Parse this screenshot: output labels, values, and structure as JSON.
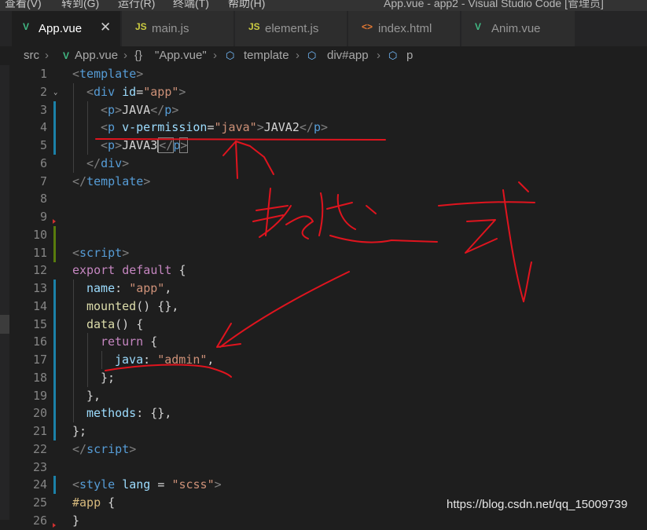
{
  "menubar": {
    "items": [
      "查看(V)",
      "转到(G)",
      "运行(R)",
      "终端(T)",
      "帮助(H)"
    ],
    "window_title": "App.vue - app2 - Visual Studio Code [管理员]"
  },
  "tabs": [
    {
      "label": "App.vue",
      "icon": "V",
      "icon_name": "vue-icon",
      "icon_color": "#41b883",
      "active": true
    },
    {
      "label": "main.js",
      "icon": "JS",
      "icon_name": "js-icon",
      "icon_color": "#cbcb41",
      "active": false
    },
    {
      "label": "element.js",
      "icon": "JS",
      "icon_name": "js-icon",
      "icon_color": "#cbcb41",
      "active": false
    },
    {
      "label": "index.html",
      "icon": "<>",
      "icon_name": "html-icon",
      "icon_color": "#e37933",
      "active": false
    },
    {
      "label": "Anim.vue",
      "icon": "V",
      "icon_name": "vue-icon",
      "icon_color": "#41b883",
      "active": false
    }
  ],
  "tab_close_glyph": "✕",
  "breadcrumb": {
    "items": [
      "src",
      "App.vue",
      "\"App.vue\"",
      "template",
      "div#app",
      "p"
    ],
    "icons": [
      "folder",
      "vue-icon",
      "braces-icon",
      "element-icon",
      "element-icon",
      "element-icon"
    ],
    "braces_glyph": "{}",
    "element_glyph": "⬡"
  },
  "code": {
    "line_numbers": [
      "1",
      "2",
      "3",
      "4",
      "5",
      "6",
      "7",
      "8",
      "9",
      "10",
      "11",
      "12",
      "13",
      "14",
      "15",
      "16",
      "17",
      "18",
      "19",
      "20",
      "21",
      "22",
      "23",
      "24",
      "25",
      "26"
    ],
    "lines": [
      [
        {
          "c": "t",
          "v": "<"
        },
        {
          "c": "tn",
          "v": "template"
        },
        {
          "c": "t",
          "v": ">"
        }
      ],
      [
        {
          "c": "t",
          "v": "<"
        },
        {
          "c": "tn",
          "v": "div"
        },
        {
          "c": "pu",
          "v": " "
        },
        {
          "c": "at",
          "v": "id"
        },
        {
          "c": "pu",
          "v": "="
        },
        {
          "c": "sv",
          "v": "\"app\""
        },
        {
          "c": "t",
          "v": ">"
        }
      ],
      [
        {
          "c": "t",
          "v": "<"
        },
        {
          "c": "tn",
          "v": "p"
        },
        {
          "c": "t",
          "v": ">"
        },
        {
          "c": "pu",
          "v": "JAVA"
        },
        {
          "c": "t",
          "v": "</"
        },
        {
          "c": "tn",
          "v": "p"
        },
        {
          "c": "t",
          "v": ">"
        }
      ],
      [
        {
          "c": "t",
          "v": "<"
        },
        {
          "c": "tn",
          "v": "p"
        },
        {
          "c": "pu",
          "v": " "
        },
        {
          "c": "at",
          "v": "v-permission"
        },
        {
          "c": "pu",
          "v": "="
        },
        {
          "c": "sv",
          "v": "\"java\""
        },
        {
          "c": "t",
          "v": ">"
        },
        {
          "c": "pu",
          "v": "JAVA2"
        },
        {
          "c": "t",
          "v": "</"
        },
        {
          "c": "tn",
          "v": "p"
        },
        {
          "c": "t",
          "v": ">"
        }
      ],
      [
        {
          "c": "t",
          "v": "<"
        },
        {
          "c": "tn",
          "v": "p"
        },
        {
          "c": "t",
          "v": ">"
        },
        {
          "c": "pu",
          "v": "JAVA3"
        },
        {
          "c": "cursor",
          "v": ""
        },
        {
          "c": "t curbox",
          "v": "</"
        },
        {
          "c": "tn",
          "v": "p"
        },
        {
          "c": "t curbox",
          "v": ">"
        }
      ],
      [
        {
          "c": "t",
          "v": "</"
        },
        {
          "c": "tn",
          "v": "div"
        },
        {
          "c": "t",
          "v": ">"
        }
      ],
      [
        {
          "c": "t",
          "v": "</"
        },
        {
          "c": "tn",
          "v": "template"
        },
        {
          "c": "t",
          "v": ">"
        }
      ],
      [],
      [],
      [],
      [
        {
          "c": "t",
          "v": "<"
        },
        {
          "c": "tn",
          "v": "script"
        },
        {
          "c": "t",
          "v": ">"
        }
      ],
      [
        {
          "c": "kw",
          "v": "export"
        },
        {
          "c": "pu",
          "v": " "
        },
        {
          "c": "kw",
          "v": "default"
        },
        {
          "c": "pu",
          "v": " {"
        }
      ],
      [
        {
          "c": "pr",
          "v": "name"
        },
        {
          "c": "pu",
          "v": ": "
        },
        {
          "c": "sv",
          "v": "\"app\""
        },
        {
          "c": "pu",
          "v": ","
        }
      ],
      [
        {
          "c": "fn",
          "v": "mounted"
        },
        {
          "c": "pu",
          "v": "() {},"
        }
      ],
      [
        {
          "c": "fn",
          "v": "data"
        },
        {
          "c": "pu",
          "v": "() {"
        }
      ],
      [
        {
          "c": "kw",
          "v": "return"
        },
        {
          "c": "pu",
          "v": " {"
        }
      ],
      [
        {
          "c": "pr",
          "v": "java"
        },
        {
          "c": "pu",
          "v": ": "
        },
        {
          "c": "sv",
          "v": "\"admin\""
        },
        {
          "c": "pu",
          "v": ","
        }
      ],
      [
        {
          "c": "pu",
          "v": "};"
        }
      ],
      [
        {
          "c": "pu",
          "v": "},"
        }
      ],
      [
        {
          "c": "pr",
          "v": "methods"
        },
        {
          "c": "pu",
          "v": ": {},"
        }
      ],
      [
        {
          "c": "pu",
          "v": "};"
        }
      ],
      [
        {
          "c": "t",
          "v": "</"
        },
        {
          "c": "tn",
          "v": "script"
        },
        {
          "c": "t",
          "v": ">"
        }
      ],
      [],
      [
        {
          "c": "t",
          "v": "<"
        },
        {
          "c": "tn",
          "v": "style"
        },
        {
          "c": "pu",
          "v": " "
        },
        {
          "c": "at",
          "v": "lang"
        },
        {
          "c": "pu",
          "v": " = "
        },
        {
          "c": "sv",
          "v": "\"scss\""
        },
        {
          "c": "t",
          "v": ">"
        }
      ],
      [
        {
          "c": "sel",
          "v": "#app"
        },
        {
          "c": "pu",
          "v": " {"
        }
      ],
      [
        {
          "c": "pu",
          "v": "}"
        }
      ]
    ],
    "indent_levels": [
      0,
      1,
      2,
      2,
      2,
      1,
      0,
      0,
      0,
      0,
      0,
      0,
      1,
      1,
      1,
      2,
      3,
      2,
      1,
      1,
      0,
      0,
      0,
      0,
      0,
      0
    ],
    "gutter_marks": [
      "",
      "",
      "blue",
      "blue",
      "blue",
      "",
      "",
      "",
      "",
      "green",
      "green",
      "",
      "blue",
      "blue",
      "blue",
      "blue",
      "blue",
      "blue",
      "blue",
      "blue",
      "blue",
      "",
      "",
      "blue",
      "",
      ""
    ],
    "fold_lines": [
      1
    ],
    "fold_glyph": "⌄",
    "deletion_marks_after": [
      8,
      25
    ]
  },
  "watermark": "https://blog.csdn.net/qq_15009739",
  "colors": {
    "editor_bg": "#1e1e1e",
    "annotation_red": "#e0141e"
  },
  "annotation": {
    "description_icon": "handwritten-red-annotation"
  }
}
